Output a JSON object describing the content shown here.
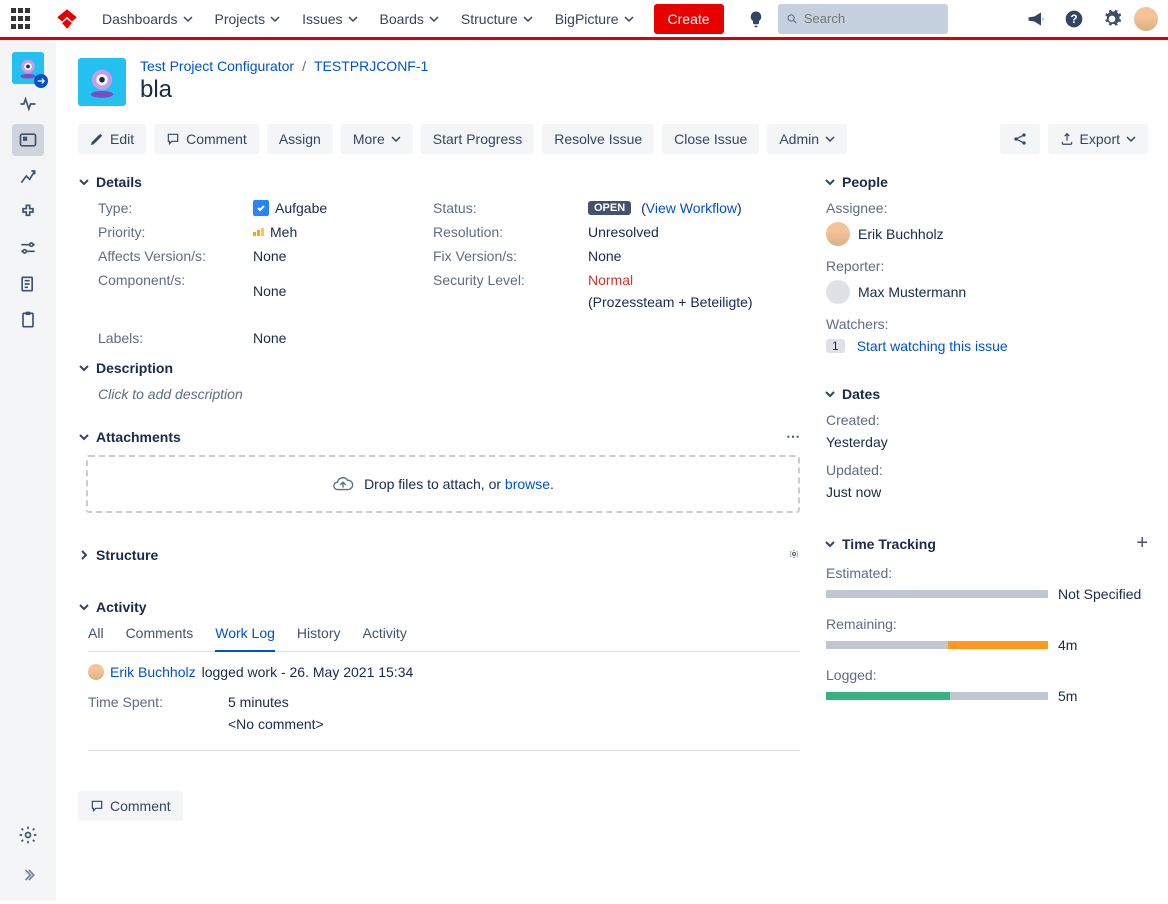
{
  "topnav": {
    "items": [
      "Dashboards",
      "Projects",
      "Issues",
      "Boards",
      "Structure",
      "BigPicture"
    ],
    "create": "Create",
    "search_placeholder": "Search"
  },
  "breadcrumb": {
    "project": "Test Project Configurator",
    "issue_key": "TESTPRJCONF-1",
    "title": "bla"
  },
  "actions": {
    "edit": "Edit",
    "comment": "Comment",
    "assign": "Assign",
    "more": "More",
    "start_progress": "Start Progress",
    "resolve": "Resolve Issue",
    "close": "Close Issue",
    "admin": "Admin",
    "export": "Export"
  },
  "sections": {
    "details": "Details",
    "description": "Description",
    "attachments": "Attachments",
    "structure": "Structure",
    "activity": "Activity",
    "people": "People",
    "dates": "Dates",
    "time_tracking": "Time Tracking"
  },
  "details": {
    "type_label": "Type:",
    "type_value": "Aufgabe",
    "priority_label": "Priority:",
    "priority_value": "Meh",
    "affects_label": "Affects Version/s:",
    "affects_value": "None",
    "components_label": "Component/s:",
    "components_value": "None",
    "labels_label": "Labels:",
    "labels_value": "None",
    "status_label": "Status:",
    "status_value": "OPEN",
    "status_workflow": "View Workflow",
    "resolution_label": "Resolution:",
    "resolution_value": "Unresolved",
    "fix_label": "Fix Version/s:",
    "fix_value": "None",
    "security_label": "Security Level:",
    "security_value_red": "Normal",
    "security_value_rest": " (Prozessteam + Beteiligte)"
  },
  "description": {
    "placeholder": "Click to add description"
  },
  "attachments": {
    "drop_prefix": "Drop files to attach, or ",
    "browse": "browse",
    "suffix": "."
  },
  "activity": {
    "tabs": [
      "All",
      "Comments",
      "Work Log",
      "History",
      "Activity"
    ],
    "active_tab": "Work Log",
    "worklog_user": "Erik Buchholz",
    "worklog_suffix": " logged work - 26. May 2021 15:34",
    "time_spent_label": "Time Spent:",
    "time_spent_value": "5 minutes",
    "no_comment": "<No comment>"
  },
  "people": {
    "assignee_label": "Assignee:",
    "assignee_name": "Erik Buchholz",
    "reporter_label": "Reporter:",
    "reporter_name": "Max Mustermann",
    "watchers_label": "Watchers:",
    "watchers_count": "1",
    "watchers_action": "Start watching this issue"
  },
  "dates": {
    "created_label": "Created:",
    "created_value": "Yesterday",
    "updated_label": "Updated:",
    "updated_value": "Just now"
  },
  "time_tracking": {
    "estimated_label": "Estimated:",
    "estimated_value": "Not Specified",
    "estimated_pct": 0,
    "remaining_label": "Remaining:",
    "remaining_value": "4m",
    "remaining_pct": 55,
    "logged_label": "Logged:",
    "logged_value": "5m",
    "logged_pct": 56
  },
  "bottom_comment": "Comment"
}
